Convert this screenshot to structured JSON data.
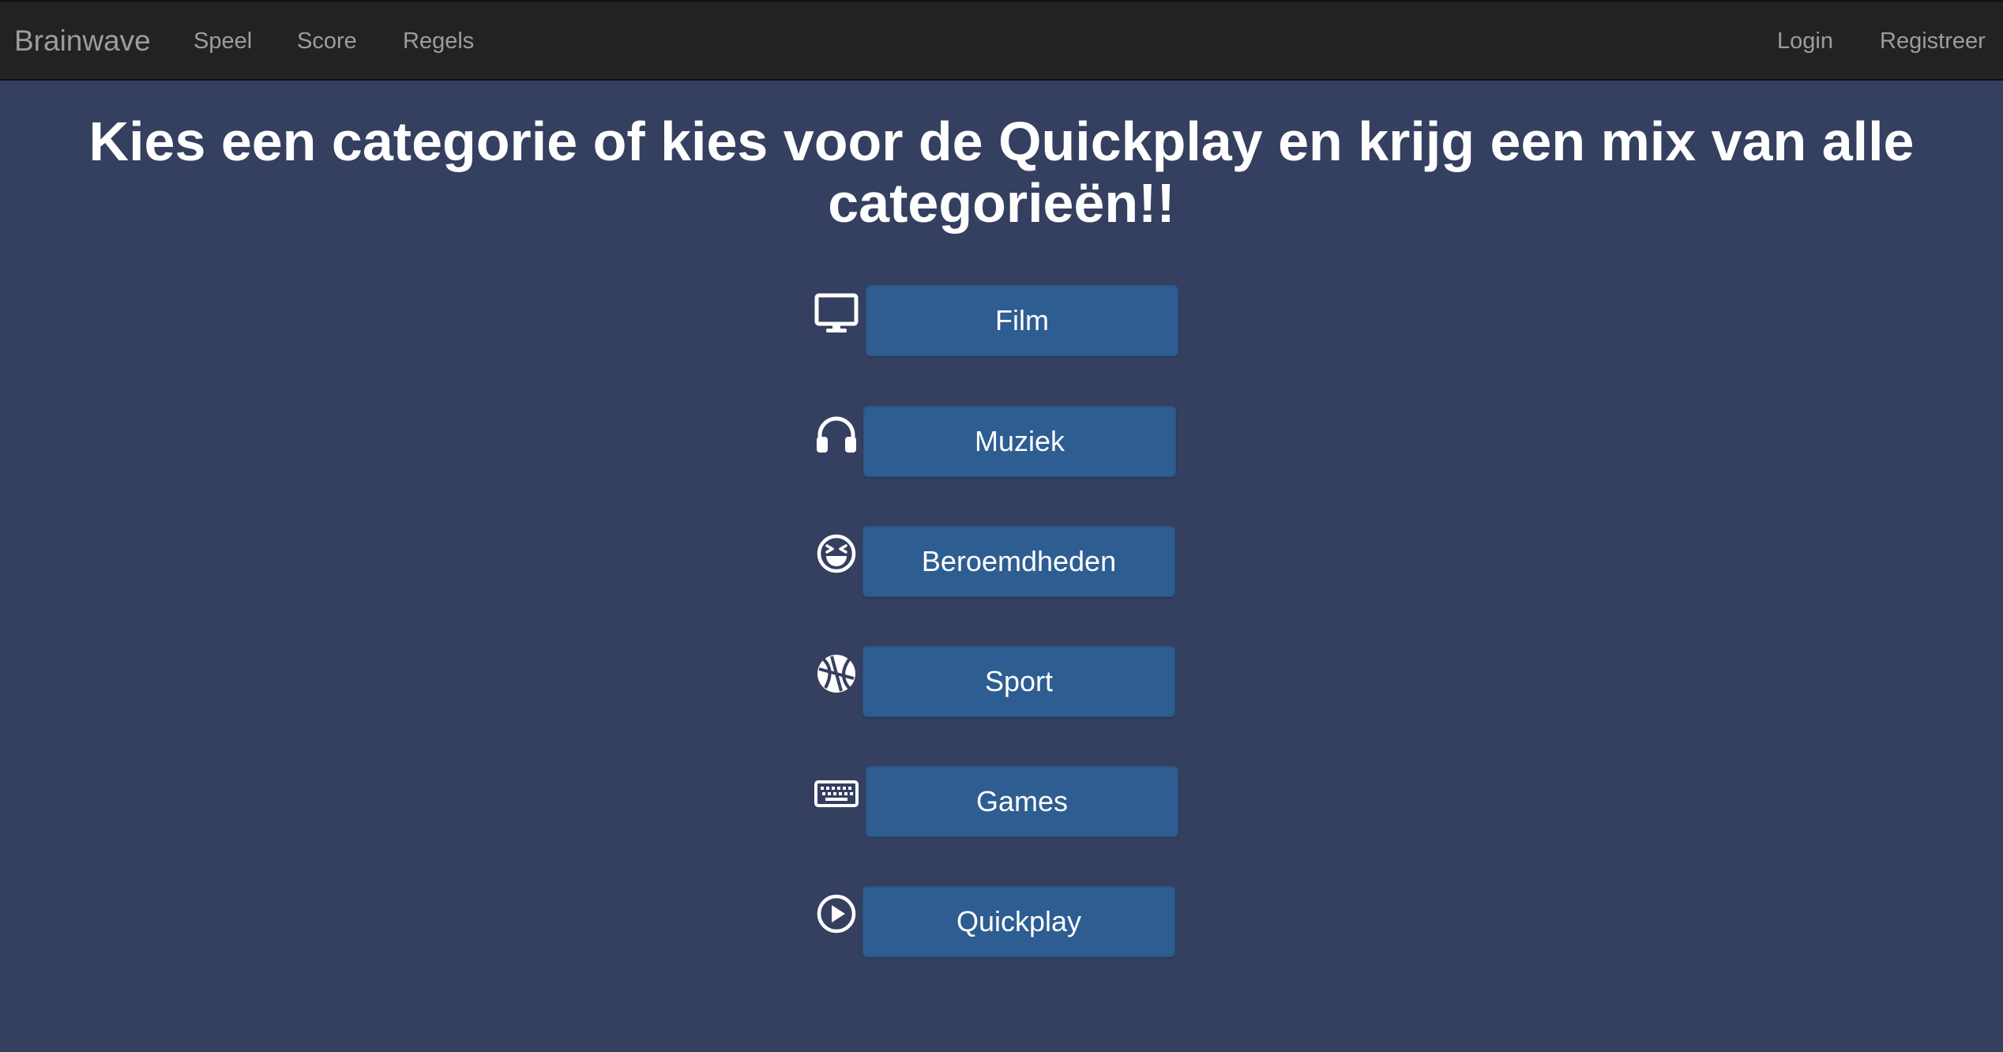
{
  "navbar": {
    "brand": "Brainwave",
    "left_links": [
      "Speel",
      "Score",
      "Regels"
    ],
    "right_links": [
      "Login",
      "Registreer"
    ]
  },
  "main": {
    "heading": "Kies een categorie of kies voor de Quickplay en krijg een mix van alle categorieën!!",
    "categories": [
      {
        "label": "Film",
        "icon": "monitor-icon"
      },
      {
        "label": "Muziek",
        "icon": "headphones-icon"
      },
      {
        "label": "Beroemdheden",
        "icon": "laughing-face-icon"
      },
      {
        "label": "Sport",
        "icon": "basketball-icon"
      },
      {
        "label": "Games",
        "icon": "keyboard-icon"
      },
      {
        "label": "Quickplay",
        "icon": "play-circle-icon"
      }
    ]
  },
  "colors": {
    "navbar_bg": "#222222",
    "navbar_text": "#9d9d9d",
    "page_bg": "#353f5f",
    "button_bg": "#2d5d91",
    "text": "#ffffff"
  }
}
